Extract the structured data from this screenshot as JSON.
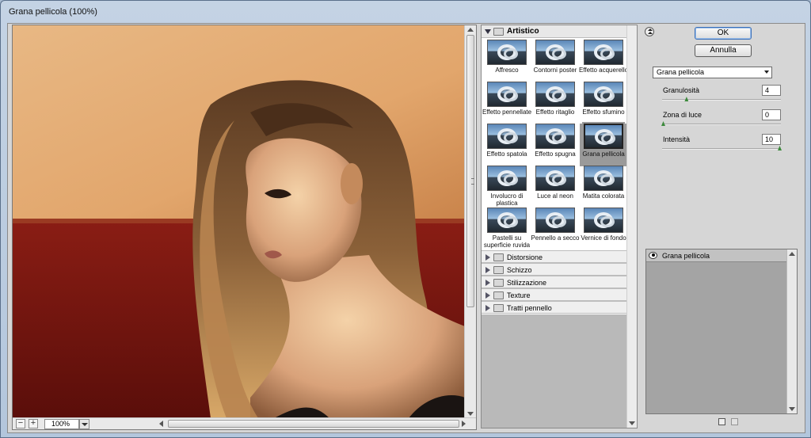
{
  "window": {
    "title": "Grana pellicola (100%)"
  },
  "preview": {
    "zoom": "100%",
    "zoom_out": "−",
    "zoom_in": "+"
  },
  "gallery": {
    "open_folder": "Artistico",
    "thumbnails": [
      {
        "label": "Affresco"
      },
      {
        "label": "Contorni poster"
      },
      {
        "label": "Effetto acquerello"
      },
      {
        "label": "Effetto pennellate"
      },
      {
        "label": "Effetto ritaglio"
      },
      {
        "label": "Effetto sfumino"
      },
      {
        "label": "Effetto spatola"
      },
      {
        "label": "Effetto spugna"
      },
      {
        "label": "Grana pellicola",
        "selected": true
      },
      {
        "label": "Involucro di plastica"
      },
      {
        "label": "Luce al neon"
      },
      {
        "label": "Matita colorata"
      },
      {
        "label": "Pastelli su superficie ruvida"
      },
      {
        "label": "Pennello a secco"
      },
      {
        "label": "Vernice di fondo"
      }
    ],
    "folders": [
      "Distorsione",
      "Schizzo",
      "Stilizzazione",
      "Texture",
      "Tratti pennello"
    ]
  },
  "controls": {
    "ok": "OK",
    "cancel": "Annulla",
    "filter_select": "Grana pellicola",
    "params": [
      {
        "label": "Granulosità",
        "value": "4",
        "min": 0,
        "max": 20,
        "level": 4
      },
      {
        "label": "Zona di luce",
        "value": "0",
        "min": 0,
        "max": 20,
        "level": 0
      },
      {
        "label": "Intensità",
        "value": "10",
        "min": 0,
        "max": 10,
        "level": 10
      }
    ]
  },
  "layers": {
    "items": [
      {
        "label": "Grana pellicola"
      }
    ]
  },
  "colors": {
    "window_frame": "#b3c6dc",
    "dialog_bg": "#d6d6d6",
    "slider_handle": "#3c8a3c"
  }
}
